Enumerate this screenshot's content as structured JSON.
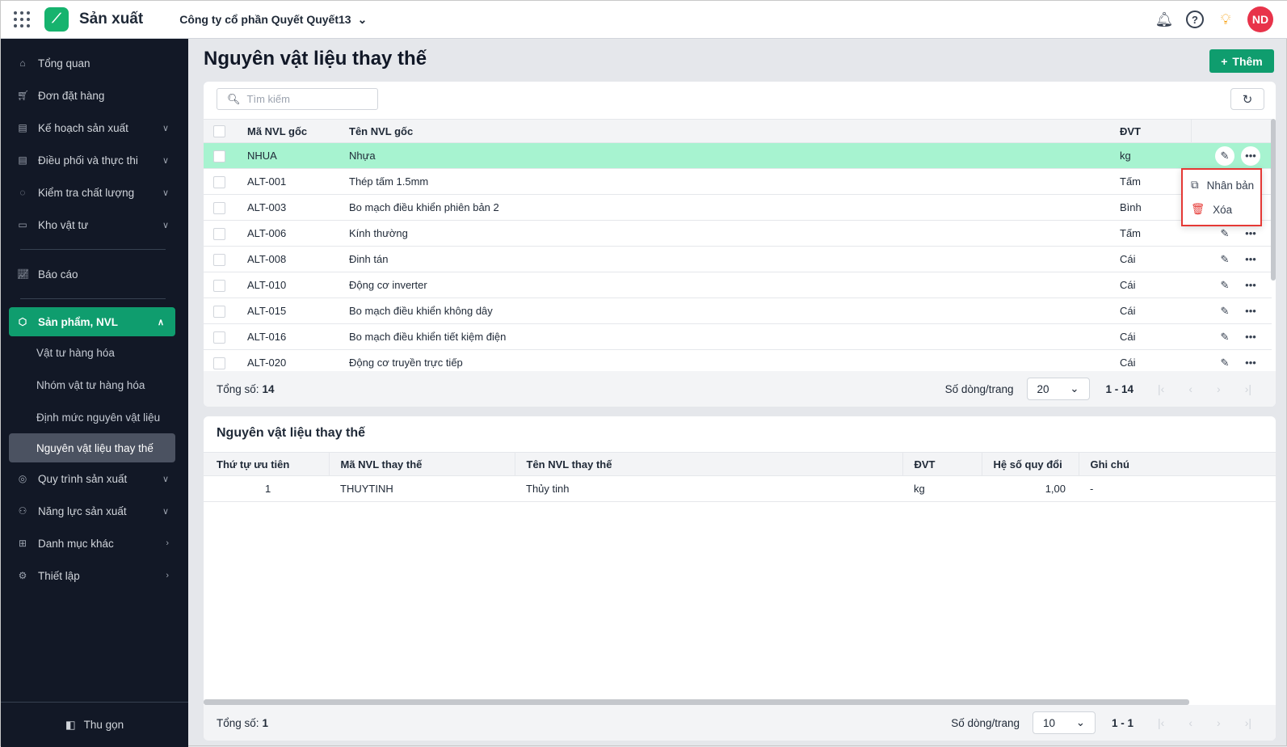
{
  "header": {
    "app_title": "Sản xuất",
    "company": "Công ty cổ phần Quyết Quyết13",
    "avatar": "ND"
  },
  "sidebar": {
    "items": [
      {
        "label": "Tổng quan",
        "icon": "home-icon"
      },
      {
        "label": "Đơn đặt hàng",
        "icon": "cart-icon"
      },
      {
        "label": "Kế hoạch sản xuất",
        "icon": "calendar-icon"
      },
      {
        "label": "Điều phối và thực thi",
        "icon": "calendar-check-icon"
      },
      {
        "label": "Kiểm tra chất lượng",
        "icon": "check-circle-icon"
      },
      {
        "label": "Kho vật tư",
        "icon": "box-icon"
      },
      {
        "label": "Báo cáo",
        "icon": "chart-icon"
      },
      {
        "label": "Sản phẩm, NVL",
        "icon": "cube-icon"
      },
      {
        "label": "Quy trình sản xuất",
        "icon": "process-icon"
      },
      {
        "label": "Năng lực sản xuất",
        "icon": "user-gear-icon"
      },
      {
        "label": "Danh mục khác",
        "icon": "grid-icon"
      },
      {
        "label": "Thiết lập",
        "icon": "gear-icon"
      }
    ],
    "subitems": [
      "Vật tư hàng hóa",
      "Nhóm vật tư hàng hóa",
      "Định mức nguyên vật liệu",
      "Nguyên vật liệu thay thế"
    ],
    "collapse": "Thu gọn"
  },
  "page": {
    "title": "Nguyên vật liệu thay thế",
    "add_label": "Thêm",
    "search_placeholder": "Tìm kiếm"
  },
  "table1": {
    "headers": [
      "Mã NVL gốc",
      "Tên NVL gốc",
      "ĐVT"
    ],
    "rows": [
      [
        "NHUA",
        "Nhựa",
        "kg"
      ],
      [
        "ALT-001",
        "Thép tấm 1.5mm",
        "Tấm"
      ],
      [
        "ALT-003",
        "Bo mạch điều khiển phiên bản 2",
        "Bình"
      ],
      [
        "ALT-006",
        "Kính thường",
        "Tấm"
      ],
      [
        "ALT-008",
        "Đinh tán",
        "Cái"
      ],
      [
        "ALT-010",
        "Động cơ inverter",
        "Cái"
      ],
      [
        "ALT-015",
        "Bo mạch điều khiển không dây",
        "Cái"
      ],
      [
        "ALT-016",
        "Bo mạch điều khiển tiết kiệm điện",
        "Cái"
      ],
      [
        "ALT-020",
        "Động cơ truyền trực tiếp",
        "Cái"
      ]
    ],
    "total_label": "Tổng số:",
    "total": "14",
    "rows_per_page_label": "Số dòng/trang",
    "rows_per_page": "20",
    "range": "1 - 14"
  },
  "menu": {
    "duplicate": "Nhân bản",
    "delete": "Xóa"
  },
  "table2": {
    "title": "Nguyên vật liệu thay thế",
    "headers": [
      "Thứ tự ưu tiên",
      "Mã NVL thay thế",
      "Tên NVL thay thế",
      "ĐVT",
      "Hệ số quy đổi",
      "Ghi chú"
    ],
    "rows": [
      [
        "1",
        "THUYTINH",
        "Thủy tinh",
        "kg",
        "1,00",
        "-"
      ]
    ],
    "total_label": "Tổng số:",
    "total": "1",
    "rows_per_page_label": "Số dòng/trang",
    "rows_per_page": "10",
    "range": "1 - 1"
  }
}
